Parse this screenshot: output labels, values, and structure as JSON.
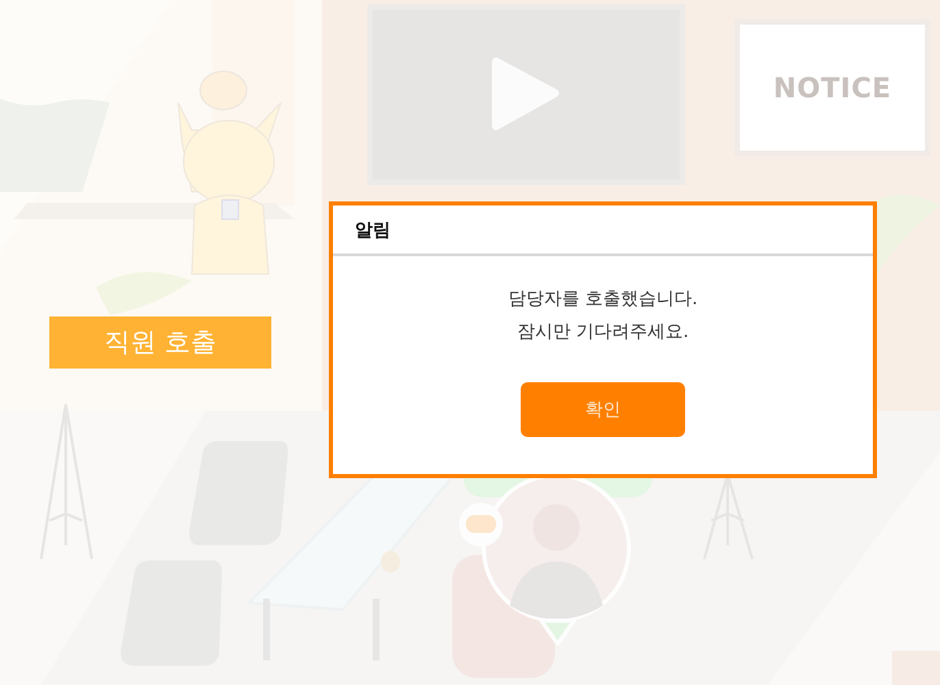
{
  "scene": {
    "notice_board": {
      "text": "NOTICE"
    },
    "staff_call_button": {
      "label": "직원 호출"
    }
  },
  "dialog": {
    "title": "알림",
    "message": [
      "담당자를 호출했습니다.",
      "잠시만 기다려주세요."
    ],
    "buttons": [
      {
        "label": "확인"
      }
    ]
  }
}
